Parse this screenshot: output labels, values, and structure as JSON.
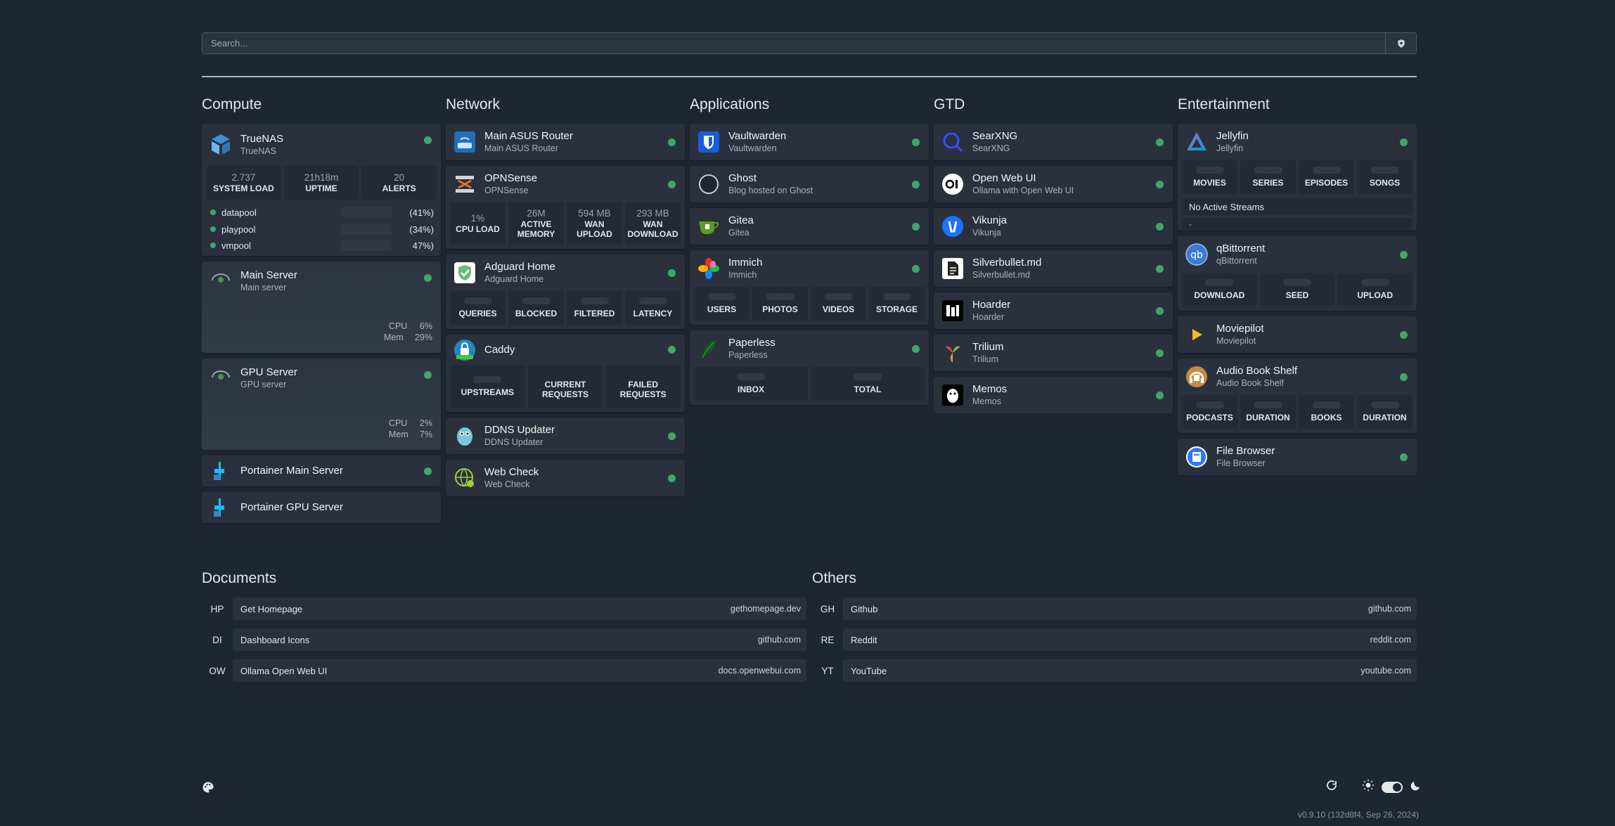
{
  "search": {
    "placeholder": "Search..."
  },
  "groups": {
    "compute": {
      "title": "Compute",
      "truenas": {
        "name": "TrueNAS",
        "desc": "TrueNAS",
        "stats": [
          {
            "v": "2.737",
            "l": "SYSTEM LOAD"
          },
          {
            "v": "21h18m",
            "l": "UPTIME"
          },
          {
            "v": "20",
            "l": "ALERTS"
          }
        ],
        "pools": [
          {
            "n": "datapool",
            "v": "(41%)"
          },
          {
            "n": "playpool",
            "v": "(34%)"
          },
          {
            "n": "vmpool",
            "v": "47%)"
          }
        ]
      },
      "main_server": {
        "name": "Main Server",
        "desc": "Main server",
        "cpu_label": "CPU",
        "cpu": "6%",
        "mem_label": "Mem",
        "mem": "29%",
        "icon_text": "Glances"
      },
      "gpu_server": {
        "name": "GPU Server",
        "desc": "GPU server",
        "cpu_label": "CPU",
        "cpu": "2%",
        "mem_label": "Mem",
        "mem": "7%",
        "icon_text": "Glances"
      },
      "portainer_main": {
        "name": "Portainer Main Server"
      },
      "portainer_gpu": {
        "name": "Portainer GPU Server"
      }
    },
    "network": {
      "title": "Network",
      "router": {
        "name": "Main ASUS Router",
        "desc": "Main ASUS Router"
      },
      "opnsense": {
        "name": "OPNSense",
        "desc": "OPNSense",
        "stats": [
          {
            "v": "1%",
            "l": "CPU LOAD"
          },
          {
            "v": "26M",
            "l": "ACTIVE MEMORY"
          },
          {
            "v": "594 MB",
            "l": "WAN UPLOAD"
          },
          {
            "v": "293 MB",
            "l": "WAN DOWNLOAD"
          }
        ]
      },
      "adguard": {
        "name": "Adguard Home",
        "desc": "Adguard Home",
        "stats": [
          "QUERIES",
          "BLOCKED",
          "FILTERED",
          "LATENCY"
        ]
      },
      "caddy": {
        "name": "Caddy",
        "stats": [
          "UPSTREAMS",
          "CURRENT REQUESTS",
          "FAILED REQUESTS"
        ]
      },
      "ddns": {
        "name": "DDNS Updater",
        "desc": "DDNS Updater"
      },
      "webcheck": {
        "name": "Web Check",
        "desc": "Web Check"
      }
    },
    "applications": {
      "title": "Applications",
      "vaultwarden": {
        "name": "Vaultwarden",
        "desc": "Vaultwarden"
      },
      "ghost": {
        "name": "Ghost",
        "desc": "Blog hosted on Ghost"
      },
      "gitea": {
        "name": "Gitea",
        "desc": "Gitea"
      },
      "immich": {
        "name": "Immich",
        "desc": "Immich",
        "stats": [
          "USERS",
          "PHOTOS",
          "VIDEOS",
          "STORAGE"
        ]
      },
      "paperless": {
        "name": "Paperless",
        "desc": "Paperless",
        "stats": [
          "INBOX",
          "TOTAL"
        ]
      }
    },
    "gtd": {
      "title": "GTD",
      "searxng": {
        "name": "SearXNG",
        "desc": "SearXNG"
      },
      "openwebui": {
        "name": "Open Web UI",
        "desc": "Ollama with Open Web UI"
      },
      "vikunja": {
        "name": "Vikunja",
        "desc": "Vikunja"
      },
      "silverbullet": {
        "name": "Silverbullet.md",
        "desc": "Silverbullet.md"
      },
      "hoarder": {
        "name": "Hoarder",
        "desc": "Hoarder"
      },
      "trilium": {
        "name": "Trilium",
        "desc": "Trilium"
      },
      "memos": {
        "name": "Memos",
        "desc": "Memos"
      }
    },
    "entertainment": {
      "title": "Entertainment",
      "jellyfin": {
        "name": "Jellyfin",
        "desc": "Jellyfin",
        "stats": [
          "MOVIES",
          "SERIES",
          "EPISODES",
          "SONGS"
        ],
        "streams": "No Active Streams",
        "dash": "-"
      },
      "qbittorrent": {
        "name": "qBittorrent",
        "desc": "qBittorrent",
        "stats": [
          "DOWNLOAD",
          "SEED",
          "UPLOAD"
        ]
      },
      "moviepilot": {
        "name": "Moviepilot",
        "desc": "Moviepilot"
      },
      "audiobookshelf": {
        "name": "Audio Book Shelf",
        "desc": "Audio Book Shelf",
        "stats": [
          "PODCASTS",
          "DURATION",
          "BOOKS",
          "DURATION"
        ]
      },
      "filebrowser": {
        "name": "File Browser",
        "desc": "File Browser"
      }
    }
  },
  "bookmarks": {
    "documents": {
      "title": "Documents",
      "items": [
        {
          "ab": "HP",
          "name": "Get Homepage",
          "url": "gethomepage.dev"
        },
        {
          "ab": "DI",
          "name": "Dashboard Icons",
          "url": "github.com"
        },
        {
          "ab": "OW",
          "name": "Ollama Open Web UI",
          "url": "docs.openwebui.com"
        }
      ]
    },
    "others": {
      "title": "Others",
      "items": [
        {
          "ab": "GH",
          "name": "Github",
          "url": "github.com"
        },
        {
          "ab": "RE",
          "name": "Reddit",
          "url": "reddit.com"
        },
        {
          "ab": "YT",
          "name": "YouTube",
          "url": "youtube.com"
        }
      ]
    }
  },
  "footer": {
    "version": "v0.9.10 (132d8f4, Sep 26, 2024)"
  },
  "colors": {
    "background": "#1f2633",
    "card": "#2a313d",
    "status_ok": "#3fa768"
  },
  "icons": [
    "search-icon",
    "shield-icon",
    "palette-icon",
    "refresh-icon",
    "sun-icon",
    "moon-icon"
  ]
}
